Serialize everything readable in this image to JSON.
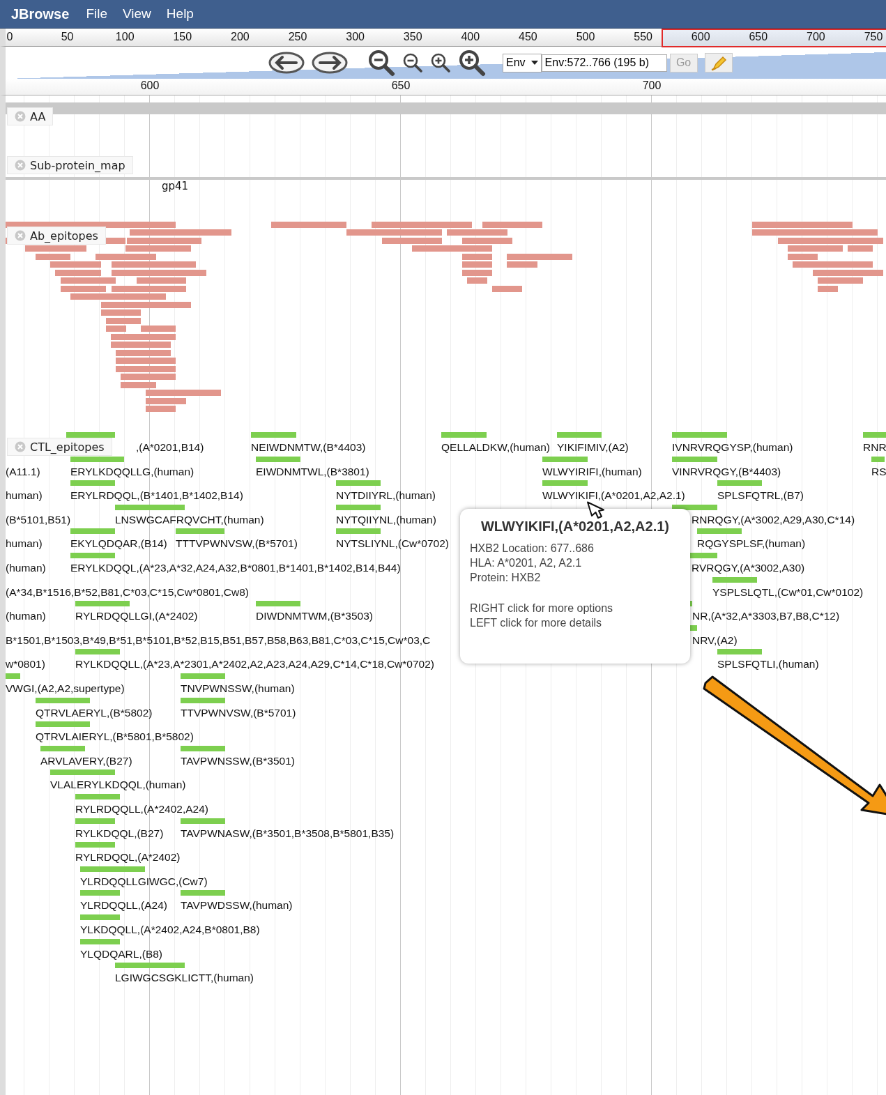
{
  "menubar": {
    "brand": "JBrowse",
    "menus": [
      "File",
      "View",
      "Help"
    ]
  },
  "overview": {
    "ticks": [
      "0",
      "50",
      "100",
      "150",
      "200",
      "250",
      "300",
      "350",
      "400",
      "450",
      "500",
      "550",
      "600",
      "650",
      "700",
      "750"
    ]
  },
  "navigation": {
    "reference": "Env",
    "location": "Env:572..766 (195 b)",
    "go": "Go"
  },
  "detail_ruler": {
    "ticks": [
      "600",
      "650",
      "700"
    ]
  },
  "tracks": [
    {
      "kind": "empty",
      "name": "AA"
    },
    {
      "kind": "subprotein",
      "name": "Sub-protein_map",
      "features": [
        "gp41"
      ]
    },
    {
      "kind": "ab",
      "name": "Ab_epitopes"
    },
    {
      "kind": "ctl",
      "name": "CTL_epitopes",
      "rows": [
        [
          ",(A*0201,B14)",
          "NEIWDNMTW,(B*4403)",
          "QELLALDKW,(human)",
          "YIKIFIMIV,(A2)",
          "IVNRVRQGYSP,(human)",
          "RNR"
        ],
        [
          "(A11.1)",
          "ERYLKDQQLLG,(human)",
          "EIWDNMTWL,(B*3801)",
          "WLWYIRIFI,(human)",
          "VINRVRQGY,(B*4403)",
          "RS"
        ],
        [
          "human)",
          "ERYLRDQQL,(B*1401,B*1402,B14)",
          "NYTDIIYRL,(human)",
          "WLWYIKIFI,(A*0201,A2,A2.1)",
          "SPLSFQTRL,(B7)"
        ],
        [
          "(B*5101,B51)",
          "LNSWGCAFRQVCHT,(human)",
          "NYTQIIYNL,(human)",
          "RNRQGY,(A*3002,A29,A30,C*14)"
        ],
        [
          "human)",
          "EKYLQDQAR,(B14)",
          "TTTVPWNVSW,(B*5701)",
          "NYTSLIYNL,(Cw*0702)",
          "RQGYSPLSF,(human)"
        ],
        [
          "(human)",
          "ERYLKDQQL,(A*23,A*32,A24,A32,B*0801,B*1401,B*1402,B14,B44)",
          "RVRQGY,(A*3002,A30)"
        ],
        [
          "(A*34,B*1516,B*52,B81,C*03,C*15,Cw*0801,Cw8)",
          "YSPLSLQTL,(Cw*01,Cw*0102)"
        ],
        [
          "(human)",
          "RYLRDQQLLGI,(A*2402)",
          "DIWDNMTWM,(B*3503)",
          "NR,(A*32,A*3303,B7,B8,C*12)"
        ],
        [
          "B*1501,B*1503,B*49,B*51,B*5101,B*52,B15,B51,B57,B58,B63,B81,C*03,C*15,Cw*03,C",
          "NRV,(A2)"
        ],
        [
          "w*0801)",
          "RYLKDQQLL,(A*23,A*2301,A*2402,A2,A23,A24,A29,C*14,C*18,Cw*0702)",
          "SPLSFQTLI,(human)"
        ],
        [
          "VWGI,(A2,A2,supertype)",
          "TNVPWNSSW,(human)"
        ],
        [
          "QTRVLAERYL,(B*5802)",
          "TTVPWNVSW,(B*5701)"
        ],
        [
          "QTRVLAIERYL,(B*5801,B*5802)"
        ],
        [
          "ARVLAVERY,(B27)",
          "TAVPWNSSW,(B*3501)"
        ],
        [
          "VLALERYLKDQQL,(human)"
        ],
        [
          "RYLRDQQLL,(A*2402,A24)"
        ],
        [
          "RYLKDQQL,(B27)",
          "TAVPWNASW,(B*3501,B*3508,B*5801,B35)"
        ],
        [
          "RYLRDQQL,(A*2402)"
        ],
        [
          "YLRDQQLLGIWGC,(Cw7)"
        ],
        [
          "YLRDQQLL,(A24)",
          "TAVPWDSSW,(human)"
        ],
        [
          "YLKDQQLL,(A*2402,A24,B*0801,B8)"
        ],
        [
          "YLQDQARL,(B8)"
        ],
        [
          "LGIWGCSGKLICTT,(human)"
        ]
      ]
    }
  ],
  "tooltip": {
    "title": "WLWYIKIFI,(A*0201,A2,A2.1)",
    "details": [
      "HXB2 Location: 677..686",
      "HLA: A*0201, A2, A2.1",
      "Protein: HXB2"
    ],
    "hints": [
      "RIGHT click for more options",
      "LEFT click for more details"
    ]
  }
}
